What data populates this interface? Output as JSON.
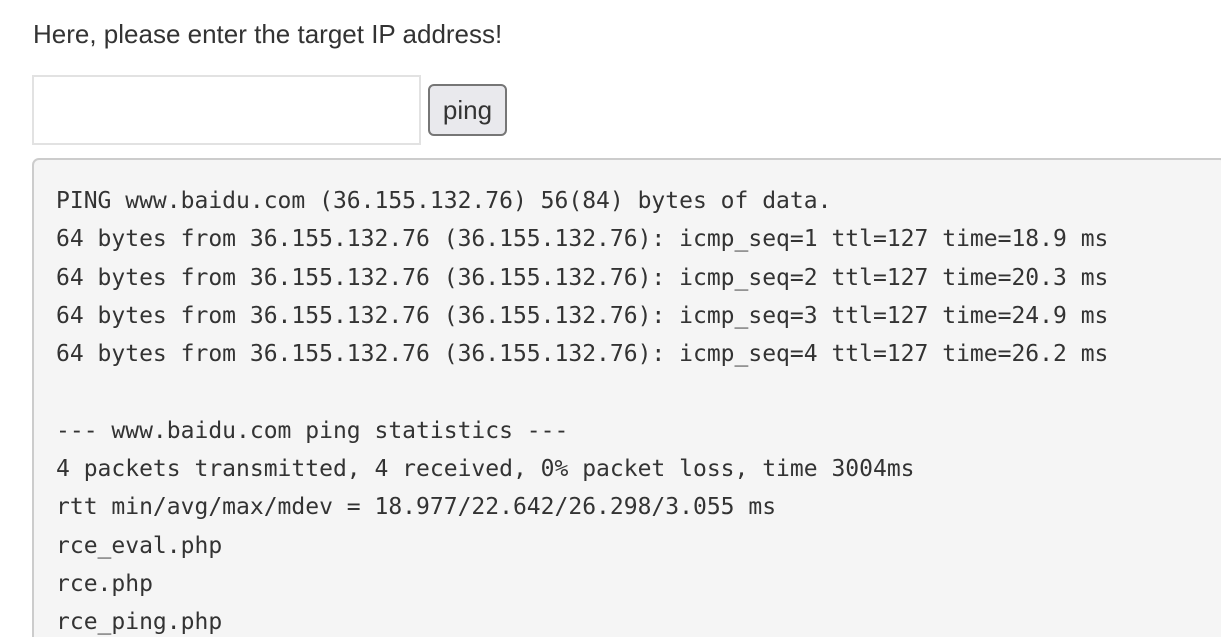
{
  "form": {
    "prompt_text": "Here, please enter the target IP address!",
    "ip_input_value": "",
    "ping_button_label": "ping"
  },
  "output": {
    "lines": [
      "PING www.baidu.com (36.155.132.76) 56(84) bytes of data.",
      "64 bytes from 36.155.132.76 (36.155.132.76): icmp_seq=1 ttl=127 time=18.9 ms",
      "64 bytes from 36.155.132.76 (36.155.132.76): icmp_seq=2 ttl=127 time=20.3 ms",
      "64 bytes from 36.155.132.76 (36.155.132.76): icmp_seq=3 ttl=127 time=24.9 ms",
      "64 bytes from 36.155.132.76 (36.155.132.76): icmp_seq=4 ttl=127 time=26.2 ms",
      "",
      "--- www.baidu.com ping statistics ---",
      "4 packets transmitted, 4 received, 0% packet loss, time 3004ms",
      "rtt min/avg/max/mdev = 18.977/22.642/26.298/3.055 ms",
      "rce_eval.php",
      "rce.php",
      "rce_ping.php"
    ]
  }
}
